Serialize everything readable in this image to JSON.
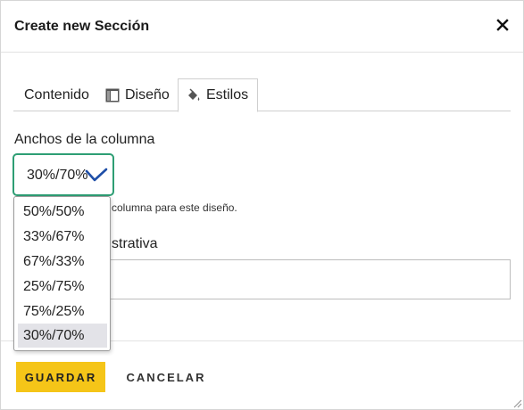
{
  "dialog": {
    "title": "Create new Sección",
    "close_icon": "close-icon"
  },
  "tabs": [
    {
      "label": "Contenido",
      "icon": ""
    },
    {
      "label": "Diseño",
      "icon": "layout-icon"
    },
    {
      "label": "Estilos",
      "icon": "paint-bucket-icon",
      "active": true
    }
  ],
  "column_widths": {
    "label": "Anchos de la columna",
    "selected": "30%/70%",
    "options": [
      "50%/50%",
      "33%/67%",
      "67%/33%",
      "25%/75%",
      "75%/25%",
      "30%/70%"
    ],
    "help_text": "columna para este diseño."
  },
  "admin_field": {
    "label_partial": "strativa",
    "value": ""
  },
  "footer": {
    "save_label": "GUARDAR",
    "cancel_label": "CANCELAR"
  },
  "colors": {
    "accent_border": "#2e9e74",
    "save_button": "#f5c518",
    "chevron": "#1f4fa8"
  }
}
